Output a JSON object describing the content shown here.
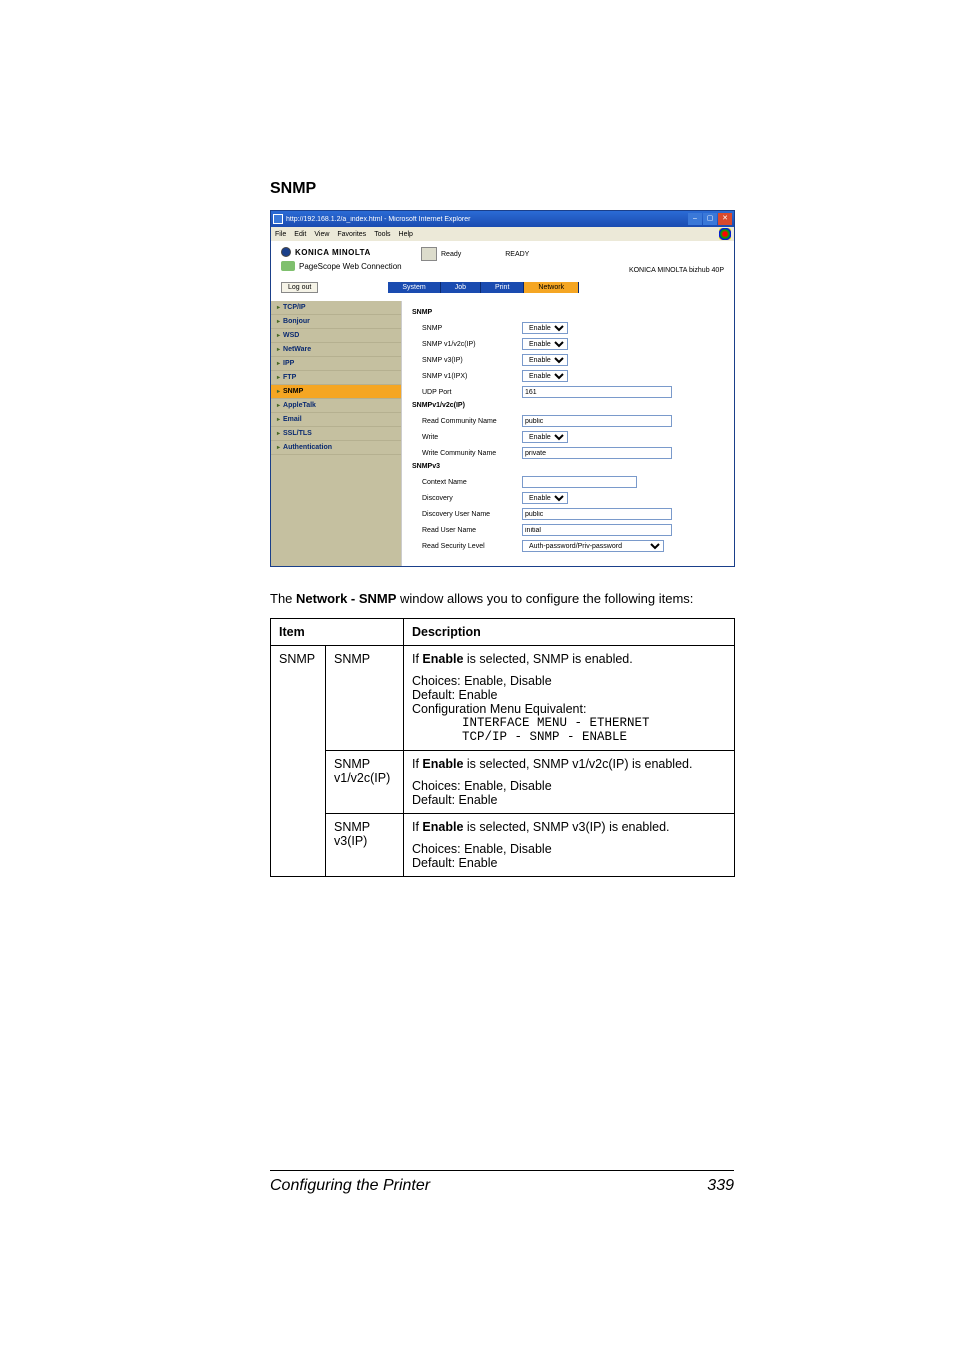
{
  "section_heading": "SNMP",
  "ie": {
    "title": "http://192.168.1.2/a_index.html - Microsoft Internet Explorer",
    "menus": [
      "File",
      "Edit",
      "View",
      "Favorites",
      "Tools",
      "Help"
    ],
    "brand": "KONICA MINOLTA",
    "brand_sub": "PageScope Web Connection",
    "ready_label": "Ready",
    "ready_big": "READY",
    "model": "KONICA MINOLTA bizhub 40P",
    "logout": "Log out",
    "tabs": [
      "System",
      "Job",
      "Print",
      "Network"
    ],
    "sidebar": [
      "TCP/IP",
      "Bonjour",
      "WSD",
      "NetWare",
      "IPP",
      "FTP",
      "SNMP",
      "AppleTalk",
      "Email",
      "SSL/TLS",
      "Authentication"
    ],
    "panel1_title": "SNMP",
    "rows1": {
      "snmp_label": "SNMP",
      "snmp_val": "Enable",
      "v1v2c_label": "SNMP v1/v2c(IP)",
      "v1v2c_val": "Enable",
      "v3ip_label": "SNMP v3(IP)",
      "v3ip_val": "Enable",
      "v1ipx_label": "SNMP v1(IPX)",
      "v1ipx_val": "Enable",
      "udp_label": "UDP Port",
      "udp_val": "161"
    },
    "panel2_title": "SNMPv1/v2c(IP)",
    "rows2": {
      "rcomm_label": "Read Community Name",
      "rcomm_val": "public",
      "write_label": "Write",
      "write_val": "Enable",
      "wcomm_label": "Write Community Name",
      "wcomm_val": "private"
    },
    "panel3_title": "SNMPv3",
    "rows3": {
      "contact_label": "Context Name",
      "contact_val": "",
      "disc_label": "Discovery",
      "disc_val": "Enable",
      "discu_label": "Discovery User Name",
      "discu_val": "public",
      "ruser_label": "Read User Name",
      "ruser_val": "initial",
      "rsec_label": "Read Security Level",
      "rsec_val": "Auth-password/Priv-password"
    }
  },
  "intro_prefix": "The ",
  "intro_bold": "Network - SNMP",
  "intro_suffix": " window allows you to configure the following items:",
  "table": {
    "h_item": "Item",
    "h_desc": "Description",
    "group": "SNMP",
    "r1_sub": "SNMP",
    "r1_line1a": "If ",
    "r1_line1b": "Enable",
    "r1_line1c": " is selected, SNMP is enabled.",
    "r1_line2": "Choices: Enable, Disable",
    "r1_line3": "Default:  Enable",
    "r1_line4": "Configuration Menu Equivalent:",
    "r1_mono1": "INTERFACE MENU - ETHERNET",
    "r1_mono2": "TCP/IP - SNMP - ENABLE",
    "r2_sub": "SNMP v1/v2c(IP)",
    "r2_line1a": "If ",
    "r2_line1b": "Enable",
    "r2_line1c": " is selected, SNMP v1/v2c(IP) is enabled.",
    "r2_line2": "Choices: Enable, Disable",
    "r2_line3": "Default:  Enable",
    "r3_sub": "SNMP v3(IP)",
    "r3_line1a": "If ",
    "r3_line1b": "Enable",
    "r3_line1c": " is selected, SNMP v3(IP) is enabled.",
    "r3_line2": "Choices: Enable, Disable",
    "r3_line3": "Default:  Enable"
  },
  "footer_left": "Configuring the Printer",
  "footer_right": "339"
}
